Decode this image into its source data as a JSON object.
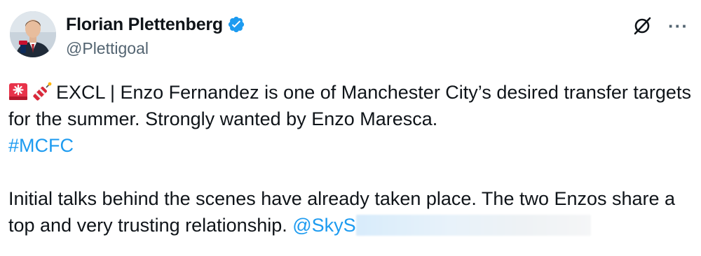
{
  "author": {
    "display_name": "Florian Plettenberg",
    "handle": "@Plettigoal",
    "verified_icon": "verified-badge-icon",
    "avatar_icon": "profile-avatar"
  },
  "header_actions": {
    "grok_icon": "grok-slash-icon",
    "more_label": "···"
  },
  "tweet": {
    "emojis": [
      "rotating-light-icon",
      "firecracker-icon"
    ],
    "para1_text": "EXCL | Enzo Fernandez is one of Manchester City’s desired transfer targets for the summer. Strongly wanted by Enzo Maresca.",
    "hashtag": "#MCFC",
    "para2_text": "Initial talks behind the scenes have already taken place. The two Enzos share a top and very trusting relationship.",
    "mention_partial": "@SkyS"
  },
  "colors": {
    "link": "#1d9bf0",
    "text": "#0f1419",
    "secondary": "#536471",
    "verified": "#1d9bf0"
  }
}
